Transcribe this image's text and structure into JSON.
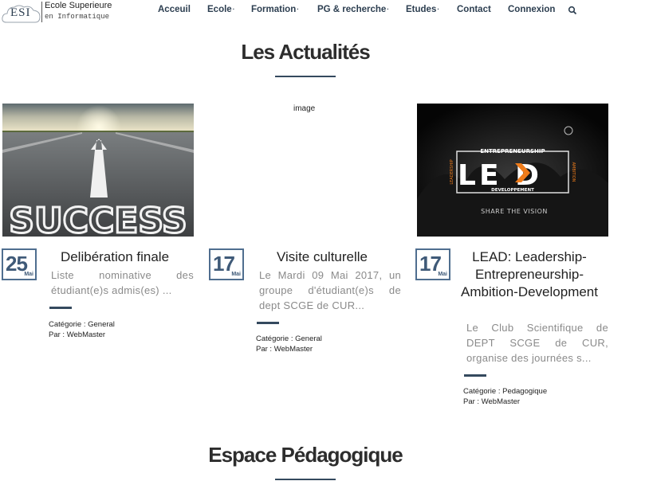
{
  "logo": {
    "mark": "ESI",
    "line1": "Ecole Superieure",
    "line2": "en Informatique"
  },
  "nav": {
    "items": [
      {
        "label": "Acceuil",
        "dropdown": false
      },
      {
        "label": "Ecole",
        "dropdown": true
      },
      {
        "label": "Formation",
        "dropdown": true
      },
      {
        "label": "PG & recherche",
        "dropdown": true
      },
      {
        "label": "Etudes",
        "dropdown": true
      },
      {
        "label": "Contact",
        "dropdown": false
      },
      {
        "label": "Connexion",
        "dropdown": false
      }
    ],
    "dropdown_marker": "·",
    "search_icon": "search-icon"
  },
  "news": {
    "title": "Les Actualités",
    "cards": [
      {
        "image_text": "SUCCESS",
        "day": "25",
        "month": "Mai",
        "title": "Delibération finale",
        "excerpt": "Liste nominative des étudiant(e)s admis(es) ...",
        "category": "Catégorie : General",
        "author": "Par : WebMaster"
      },
      {
        "image_alt": "image",
        "day": "17",
        "month": "Mai",
        "title": "Visite culturelle",
        "excerpt": "Le Mardi 09 Mai 2017, un groupe d'étudiant(e)s de dept SCGE de CUR...",
        "category": "Catégorie : General",
        "author": "Par : WebMaster"
      },
      {
        "image_text": {
          "top": "ENTREPRENEURSHIP",
          "main": "LE  D",
          "bottom": "DEVELOPPEMENT",
          "left": "LEADERSHIP",
          "right": "AMBITION",
          "tagline": "SHARE THE VISION"
        },
        "day": "17",
        "month": "Mai",
        "title": "LEAD: Leadership-Entrepreneurship-Ambition-Development",
        "excerpt": "Le Club Scientifique de DEPT SCGE de CUR, organise des journées s...",
        "category": "Catégorie : Pedagogique",
        "author": "Par : WebMaster"
      }
    ]
  },
  "pedagogy": {
    "title": "Espace Pédagogique"
  },
  "colors": {
    "primary": "#34495e",
    "date_border": "#4f6e8f",
    "accent_orange": "#f07c1a"
  }
}
